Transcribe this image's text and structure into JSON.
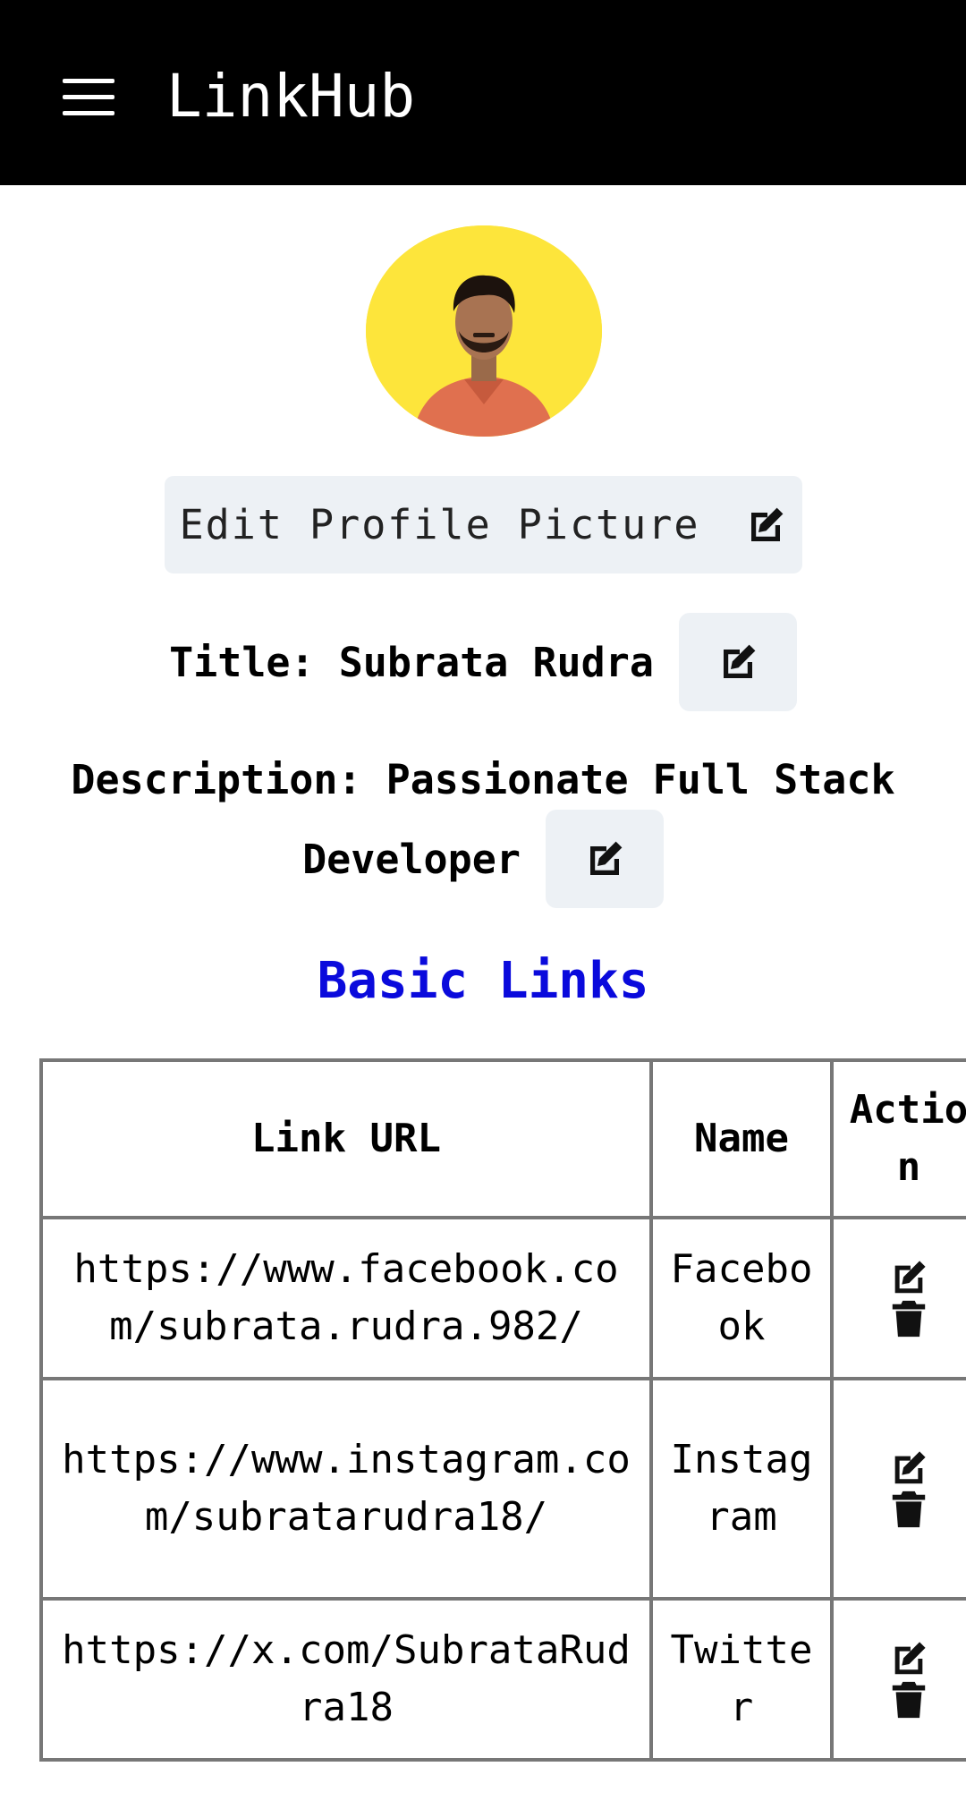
{
  "appbar": {
    "title": "LinkHub",
    "menu_icon": "hamburger-menu-icon"
  },
  "profile": {
    "edit_picture_label": "Edit Profile Picture",
    "title_text": "Title: Subrata Rudra",
    "description_line1": "Description: Passionate Full Stack",
    "description_line2": "Developer"
  },
  "basic_links": {
    "heading": "Basic Links",
    "headers": {
      "url": "Link URL",
      "name": "Name",
      "action": "Action"
    },
    "rows": [
      {
        "url": "https://www.facebook.com/subrata.rudra.982/",
        "name": "Facebook"
      },
      {
        "url": "https://www.instagram.com/subratarudra18/",
        "name": "Instagram"
      },
      {
        "url": "https://x.com/SubrataRudra18",
        "name": "Twitter"
      }
    ]
  },
  "colors": {
    "appbar_bg": "#000000",
    "avatar_bg": "#fde53b",
    "button_bg": "#edf1f5",
    "heading_blue": "#0a0adc",
    "table_border": "#777777"
  }
}
